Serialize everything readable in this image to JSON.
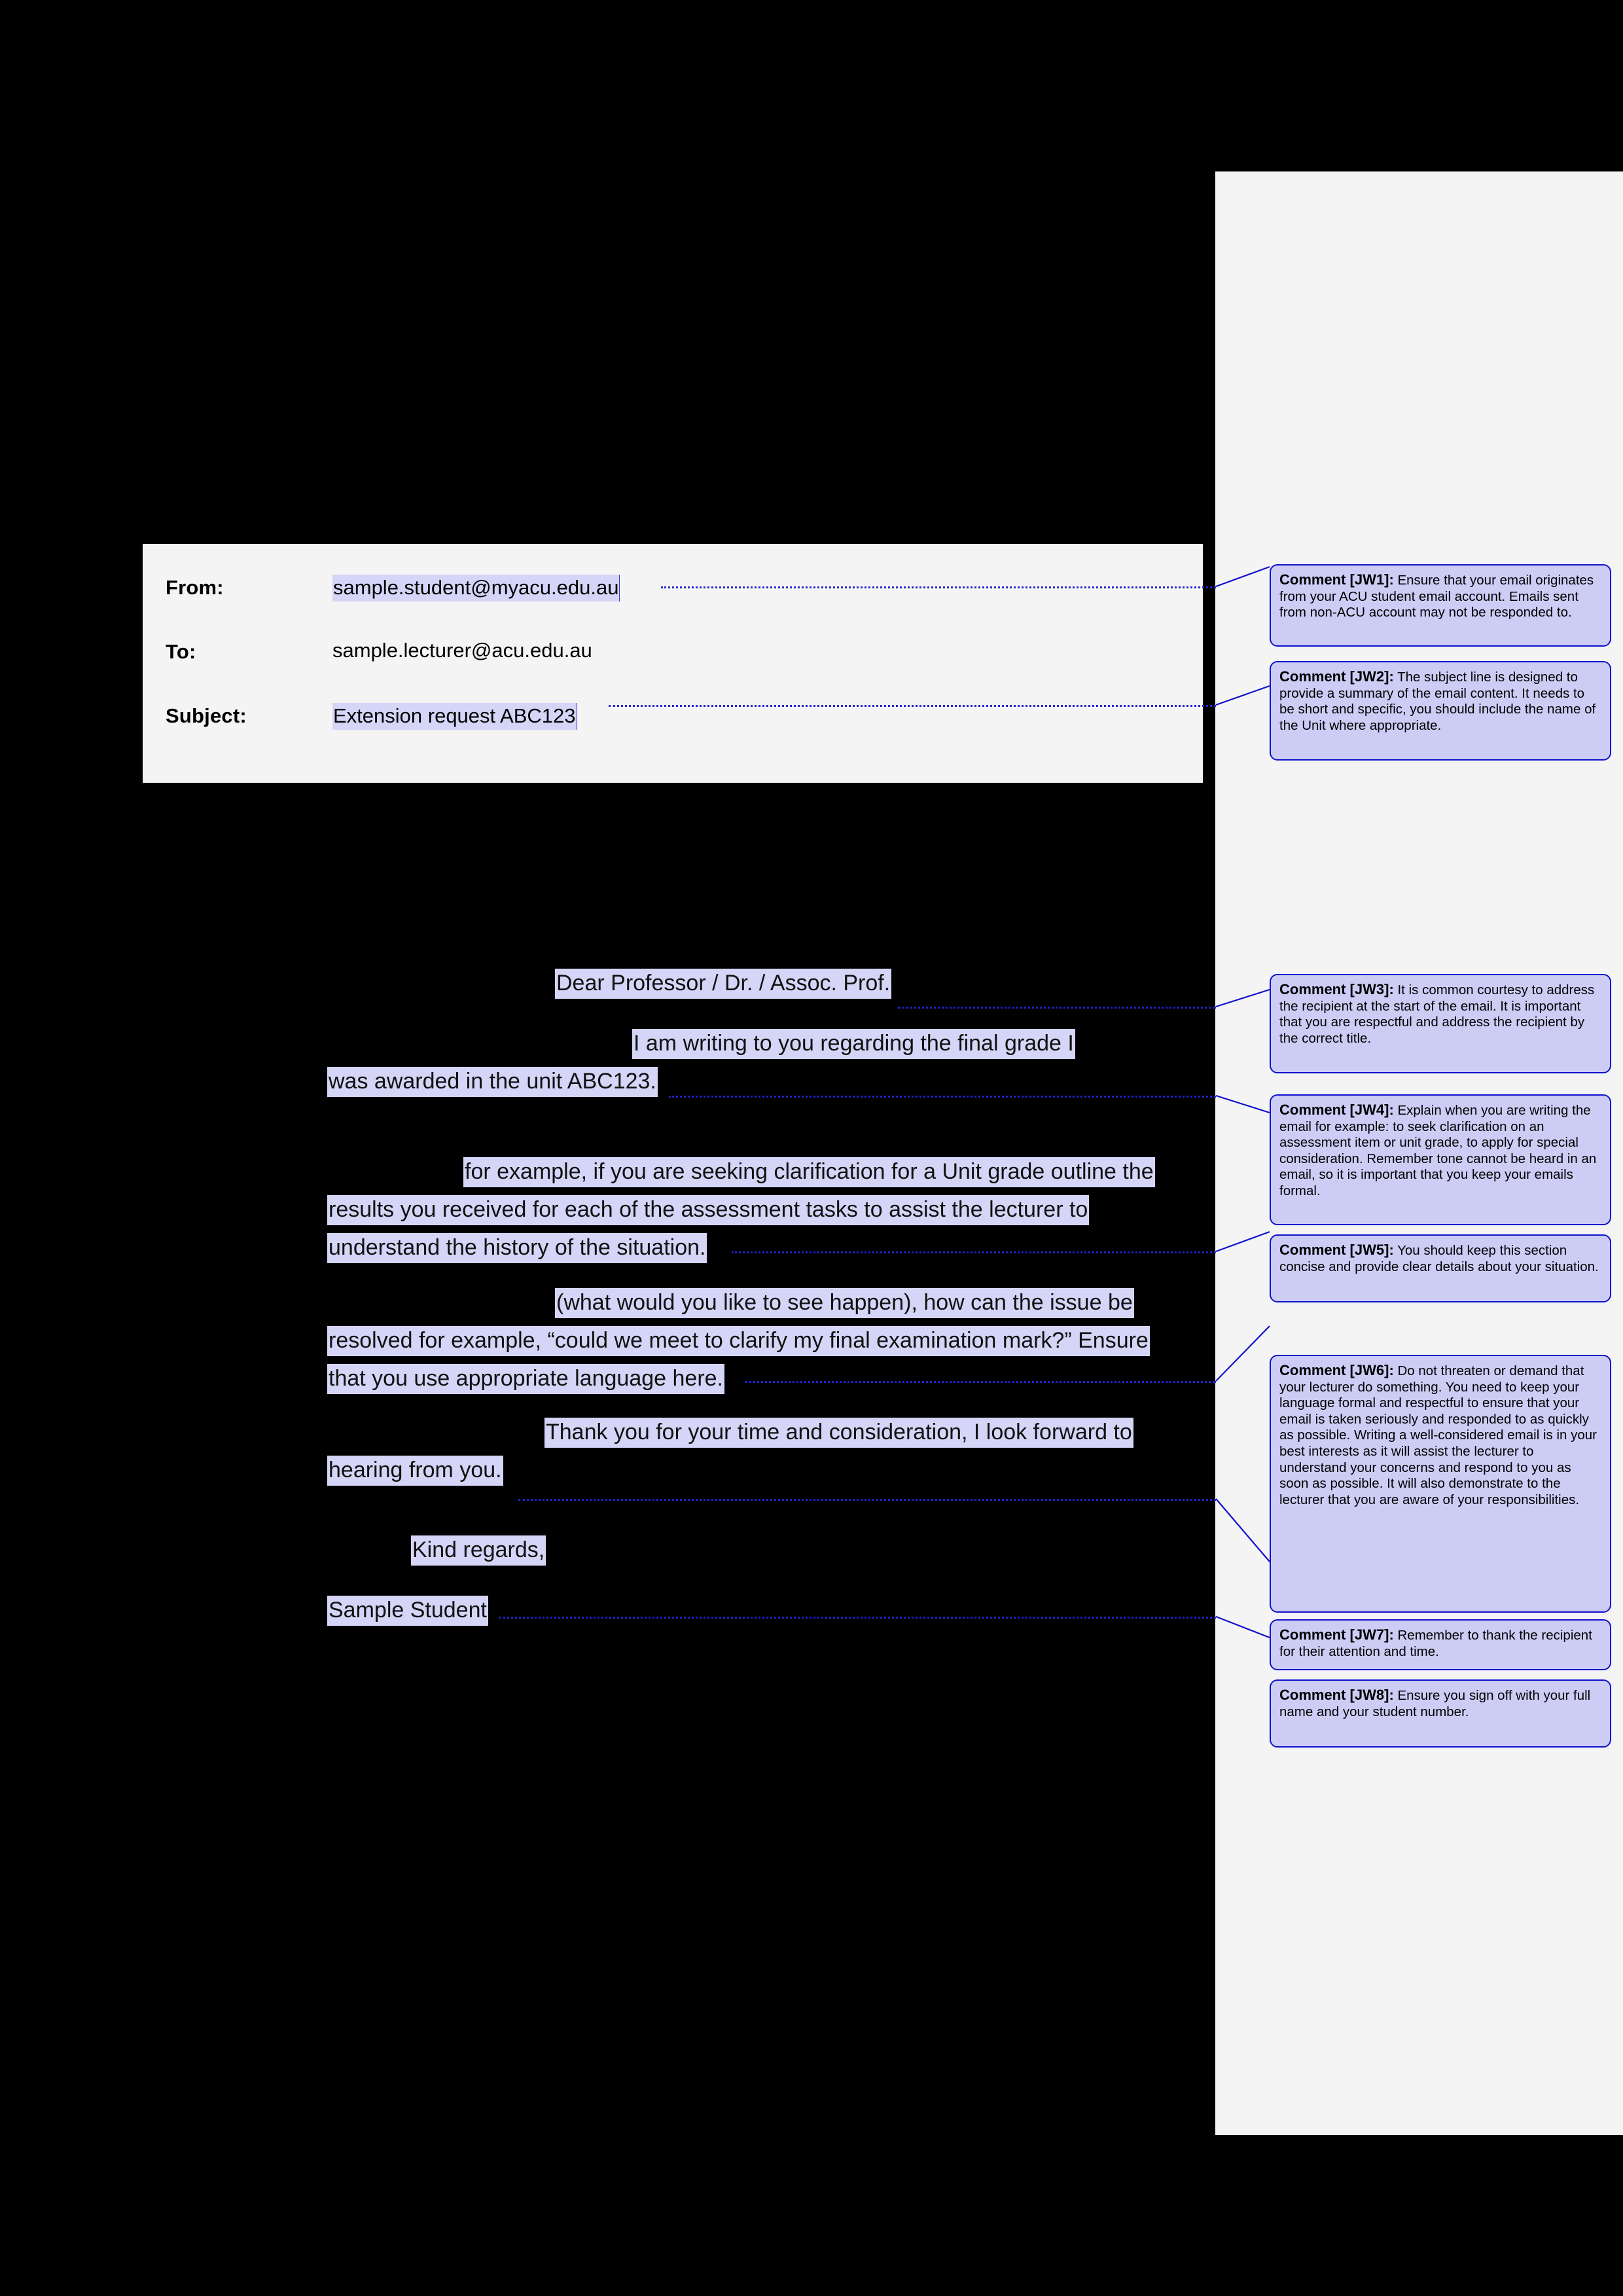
{
  "document": {
    "type": "annotated-email-template",
    "page_background": "#000000",
    "paper_color": "#f4f4f4",
    "highlight_color": "#d5d5f7",
    "comment_fill": "#ccccf5",
    "comment_border": "#1111cc"
  },
  "email_header": {
    "rows": [
      {
        "label": "From:",
        "value": "sample.student@myacu.edu.au",
        "highlighted": true
      },
      {
        "label": "To:",
        "value": "sample.lecturer@acu.edu.au",
        "highlighted": false
      },
      {
        "label": "Subject:",
        "value": "Extension request ABC123",
        "highlighted": true
      }
    ]
  },
  "letter_body": {
    "paragraphs": [
      {
        "id": "salutation",
        "lines": [
          "Dear Professor / Dr. / Assoc. Prof."
        ],
        "first_line_indent": true
      },
      {
        "id": "opening",
        "lines": [
          "I am writing to you regarding the final grade I",
          "was awarded in the unit ABC123."
        ],
        "first_line_indent": true
      },
      {
        "id": "detail",
        "lines": [
          "for example, if you are seeking clarification for a Unit grade outline the",
          "results you received for each of the assessment tasks to assist the lecturer to",
          "understand the history of the situation."
        ],
        "first_line_indent": true
      },
      {
        "id": "resolution",
        "lines": [
          "(what would you like to see happen), how can the issue be",
          "resolved for example, “could we meet to clarify my final examination mark?” Ensure",
          "that you use appropriate language here."
        ],
        "first_line_indent": true
      },
      {
        "id": "closing-thanks",
        "lines": [
          "Thank you for your time and consideration, I look forward to",
          "hearing from you."
        ],
        "first_line_indent": true
      },
      {
        "id": "signoff",
        "lines": [
          "Kind regards,"
        ],
        "first_line_indent": true
      },
      {
        "id": "signature",
        "lines": [
          "Sample Student"
        ],
        "first_line_indent": false
      }
    ]
  },
  "comments": [
    {
      "id": "JW1",
      "label": "Comment [JW1]:",
      "text": "Ensure that your email originates from your ACU student email account. Emails sent from non-ACU account may not be responded to."
    },
    {
      "id": "JW2",
      "label": "Comment [JW2]:",
      "text": "The subject line is designed to provide a summary of the email content. It needs to be short and specific, you should include the name of the Unit where appropriate."
    },
    {
      "id": "JW3",
      "label": "Comment [JW3]:",
      "text": "It is common courtesy to address the recipient at the start of the email. It is important that you are respectful and address the recipient by the correct title."
    },
    {
      "id": "JW4",
      "label": "Comment [JW4]:",
      "text": "Explain when you are writing the email for example: to seek clarification on an assessment item or unit grade, to apply for special consideration. Remember tone cannot be heard in an email, so it is important that you keep your emails formal."
    },
    {
      "id": "JW5",
      "label": "Comment [JW5]:",
      "text": "You should keep this section concise and provide clear details about your situation."
    },
    {
      "id": "JW6",
      "label": "Comment [JW6]:",
      "text": "Do not threaten or demand that your lecturer do something. You need to keep your language formal and respectful to ensure that your email is taken seriously and responded to as quickly as possible.  Writing a well-considered email is in your best interests as it will assist the lecturer to understand your concerns and respond to you as soon as possible. It will also demonstrate to the lecturer that you are aware of your responsibilities."
    },
    {
      "id": "JW7",
      "label": "Comment [JW7]:",
      "text": "Remember to thank the recipient for their attention and time."
    },
    {
      "id": "JW8",
      "label": "Comment [JW8]:",
      "text": "Ensure you sign off with your full name and your student number."
    }
  ]
}
